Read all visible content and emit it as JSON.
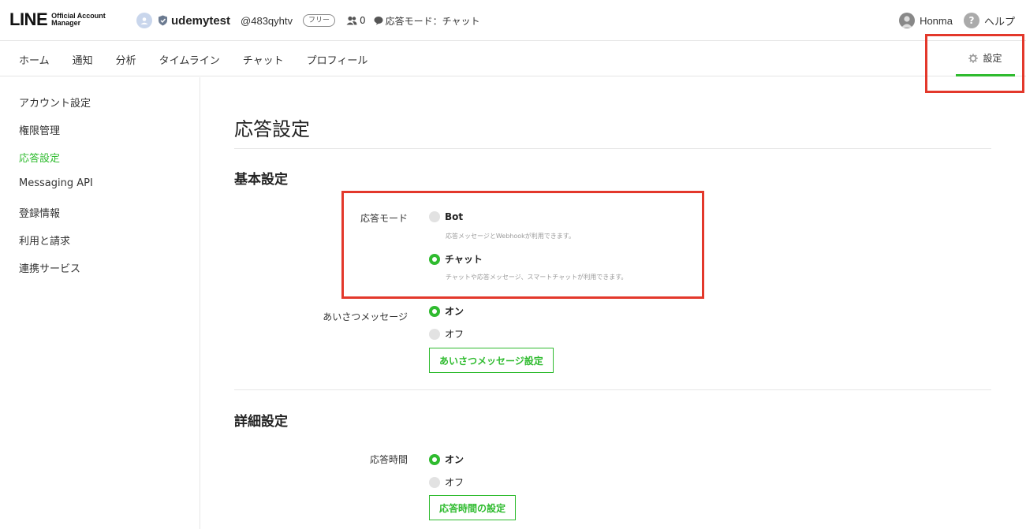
{
  "header": {
    "logo": {
      "brand": "LINE",
      "line1": "Official Account",
      "line2": "Manager"
    },
    "account_name": "udemytest",
    "account_id": "@483qyhtv",
    "plan": "フリー",
    "friend_count": "0",
    "mode_status": "応答モード：チャット",
    "user_name": "Honma",
    "help_label": "ヘルプ"
  },
  "nav": {
    "items": [
      "ホーム",
      "通知",
      "分析",
      "タイムライン",
      "チャット",
      "プロフィール"
    ],
    "settings_label": "設定"
  },
  "sidebar": {
    "items": [
      "アカウント設定",
      "権限管理",
      "応答設定",
      "Messaging API",
      "登録情報",
      "利用と請求",
      "連携サービス"
    ],
    "active_index": 2
  },
  "main": {
    "title": "応答設定",
    "basic": {
      "title": "基本設定",
      "response_mode": {
        "label": "応答モード",
        "options": [
          {
            "label": "Bot",
            "desc": "応答メッセージとWebhookが利用できます。",
            "selected": false
          },
          {
            "label": "チャット",
            "desc": "チャットや応答メッセージ、スマートチャットが利用できます。",
            "selected": true
          }
        ]
      },
      "greeting": {
        "label": "あいさつメッセージ",
        "on_label": "オン",
        "off_label": "オフ",
        "value": "on",
        "button": "あいさつメッセージ設定"
      }
    },
    "detail": {
      "title": "詳細設定",
      "response_time": {
        "label": "応答時間",
        "on_label": "オン",
        "off_label": "オフ",
        "value": "on",
        "button": "応答時間の設定"
      }
    }
  },
  "colors": {
    "accent": "#2fbb2f",
    "highlight": "#e3382b"
  }
}
